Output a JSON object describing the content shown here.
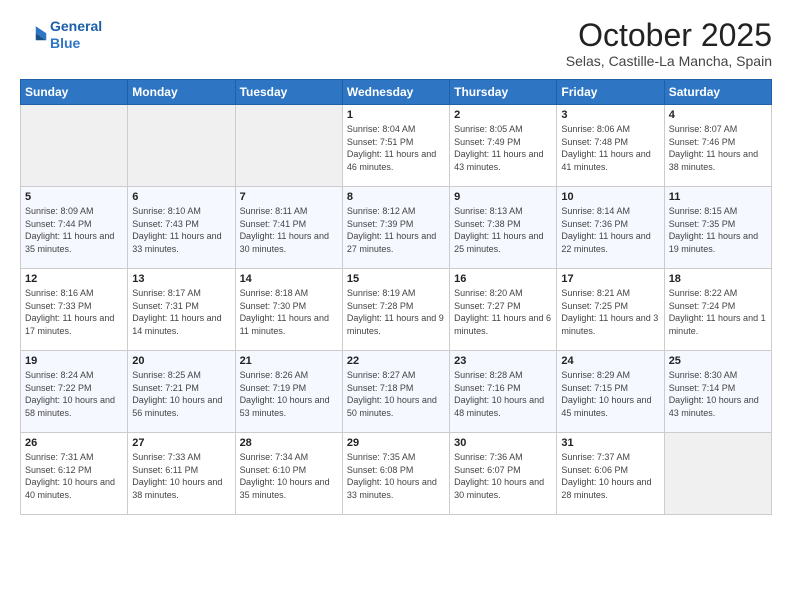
{
  "header": {
    "logo_line1": "General",
    "logo_line2": "Blue",
    "month": "October 2025",
    "location": "Selas, Castille-La Mancha, Spain"
  },
  "weekdays": [
    "Sunday",
    "Monday",
    "Tuesday",
    "Wednesday",
    "Thursday",
    "Friday",
    "Saturday"
  ],
  "weeks": [
    [
      {
        "day": "",
        "info": ""
      },
      {
        "day": "",
        "info": ""
      },
      {
        "day": "",
        "info": ""
      },
      {
        "day": "1",
        "info": "Sunrise: 8:04 AM\nSunset: 7:51 PM\nDaylight: 11 hours and 46 minutes."
      },
      {
        "day": "2",
        "info": "Sunrise: 8:05 AM\nSunset: 7:49 PM\nDaylight: 11 hours and 43 minutes."
      },
      {
        "day": "3",
        "info": "Sunrise: 8:06 AM\nSunset: 7:48 PM\nDaylight: 11 hours and 41 minutes."
      },
      {
        "day": "4",
        "info": "Sunrise: 8:07 AM\nSunset: 7:46 PM\nDaylight: 11 hours and 38 minutes."
      }
    ],
    [
      {
        "day": "5",
        "info": "Sunrise: 8:09 AM\nSunset: 7:44 PM\nDaylight: 11 hours and 35 minutes."
      },
      {
        "day": "6",
        "info": "Sunrise: 8:10 AM\nSunset: 7:43 PM\nDaylight: 11 hours and 33 minutes."
      },
      {
        "day": "7",
        "info": "Sunrise: 8:11 AM\nSunset: 7:41 PM\nDaylight: 11 hours and 30 minutes."
      },
      {
        "day": "8",
        "info": "Sunrise: 8:12 AM\nSunset: 7:39 PM\nDaylight: 11 hours and 27 minutes."
      },
      {
        "day": "9",
        "info": "Sunrise: 8:13 AM\nSunset: 7:38 PM\nDaylight: 11 hours and 25 minutes."
      },
      {
        "day": "10",
        "info": "Sunrise: 8:14 AM\nSunset: 7:36 PM\nDaylight: 11 hours and 22 minutes."
      },
      {
        "day": "11",
        "info": "Sunrise: 8:15 AM\nSunset: 7:35 PM\nDaylight: 11 hours and 19 minutes."
      }
    ],
    [
      {
        "day": "12",
        "info": "Sunrise: 8:16 AM\nSunset: 7:33 PM\nDaylight: 11 hours and 17 minutes."
      },
      {
        "day": "13",
        "info": "Sunrise: 8:17 AM\nSunset: 7:31 PM\nDaylight: 11 hours and 14 minutes."
      },
      {
        "day": "14",
        "info": "Sunrise: 8:18 AM\nSunset: 7:30 PM\nDaylight: 11 hours and 11 minutes."
      },
      {
        "day": "15",
        "info": "Sunrise: 8:19 AM\nSunset: 7:28 PM\nDaylight: 11 hours and 9 minutes."
      },
      {
        "day": "16",
        "info": "Sunrise: 8:20 AM\nSunset: 7:27 PM\nDaylight: 11 hours and 6 minutes."
      },
      {
        "day": "17",
        "info": "Sunrise: 8:21 AM\nSunset: 7:25 PM\nDaylight: 11 hours and 3 minutes."
      },
      {
        "day": "18",
        "info": "Sunrise: 8:22 AM\nSunset: 7:24 PM\nDaylight: 11 hours and 1 minute."
      }
    ],
    [
      {
        "day": "19",
        "info": "Sunrise: 8:24 AM\nSunset: 7:22 PM\nDaylight: 10 hours and 58 minutes."
      },
      {
        "day": "20",
        "info": "Sunrise: 8:25 AM\nSunset: 7:21 PM\nDaylight: 10 hours and 56 minutes."
      },
      {
        "day": "21",
        "info": "Sunrise: 8:26 AM\nSunset: 7:19 PM\nDaylight: 10 hours and 53 minutes."
      },
      {
        "day": "22",
        "info": "Sunrise: 8:27 AM\nSunset: 7:18 PM\nDaylight: 10 hours and 50 minutes."
      },
      {
        "day": "23",
        "info": "Sunrise: 8:28 AM\nSunset: 7:16 PM\nDaylight: 10 hours and 48 minutes."
      },
      {
        "day": "24",
        "info": "Sunrise: 8:29 AM\nSunset: 7:15 PM\nDaylight: 10 hours and 45 minutes."
      },
      {
        "day": "25",
        "info": "Sunrise: 8:30 AM\nSunset: 7:14 PM\nDaylight: 10 hours and 43 minutes."
      }
    ],
    [
      {
        "day": "26",
        "info": "Sunrise: 7:31 AM\nSunset: 6:12 PM\nDaylight: 10 hours and 40 minutes."
      },
      {
        "day": "27",
        "info": "Sunrise: 7:33 AM\nSunset: 6:11 PM\nDaylight: 10 hours and 38 minutes."
      },
      {
        "day": "28",
        "info": "Sunrise: 7:34 AM\nSunset: 6:10 PM\nDaylight: 10 hours and 35 minutes."
      },
      {
        "day": "29",
        "info": "Sunrise: 7:35 AM\nSunset: 6:08 PM\nDaylight: 10 hours and 33 minutes."
      },
      {
        "day": "30",
        "info": "Sunrise: 7:36 AM\nSunset: 6:07 PM\nDaylight: 10 hours and 30 minutes."
      },
      {
        "day": "31",
        "info": "Sunrise: 7:37 AM\nSunset: 6:06 PM\nDaylight: 10 hours and 28 minutes."
      },
      {
        "day": "",
        "info": ""
      }
    ]
  ]
}
